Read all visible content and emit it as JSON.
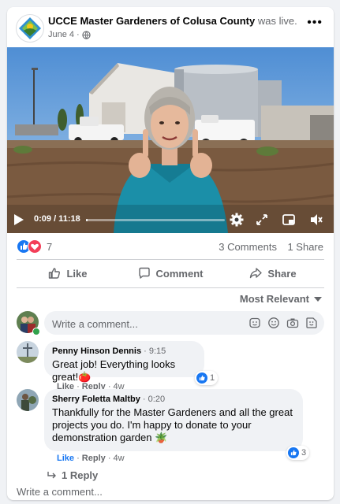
{
  "post": {
    "page_name": "UCCE Master Gardeners of Colusa County",
    "verb": "was live.",
    "date": "June 4",
    "separator": "·",
    "more_icon": "more-horizontal-icon"
  },
  "video": {
    "time": "0:09 / 11:18",
    "progress_fraction": 0.013,
    "controls": [
      "play-icon",
      "settings-gear-icon",
      "expand-icon",
      "picture-in-picture-icon",
      "volume-muted-icon"
    ]
  },
  "reactions": {
    "count": "7",
    "types": [
      "like",
      "love"
    ],
    "comments": "3 Comments",
    "shares": "1 Share"
  },
  "actions": {
    "like": "Like",
    "comment": "Comment",
    "share": "Share"
  },
  "sort": {
    "label": "Most Relevant"
  },
  "compose": {
    "placeholder": "Write a comment...",
    "icons": [
      "sticker-icon",
      "emoji-icon",
      "camera-icon",
      "gif-icon"
    ]
  },
  "comments": [
    {
      "author": "Penny Hinson Dennis",
      "time": "9:15",
      "text": "Great job! Everything looks great!🍅",
      "like_label": "Like",
      "reply_label": "Reply",
      "age": "4w",
      "reaction_count": "1"
    },
    {
      "author": "Sherry Foletta Maltby",
      "time": "0:20",
      "text": "Thankfully for the Master Gardeners and all the great projects you do. I'm happy to donate to your demonstration garden 🪴",
      "like_label": "Like",
      "reply_label": "Reply",
      "age": "4w",
      "reaction_count": "3"
    }
  ],
  "replies_link": "1 Reply",
  "bottom_compose": {
    "placeholder": "Write a comment..."
  },
  "colors": {
    "facebook_blue": "#1877f2",
    "love_red": "#f33e58",
    "muted_text": "#65676b",
    "bubble_bg": "#f0f2f5"
  }
}
